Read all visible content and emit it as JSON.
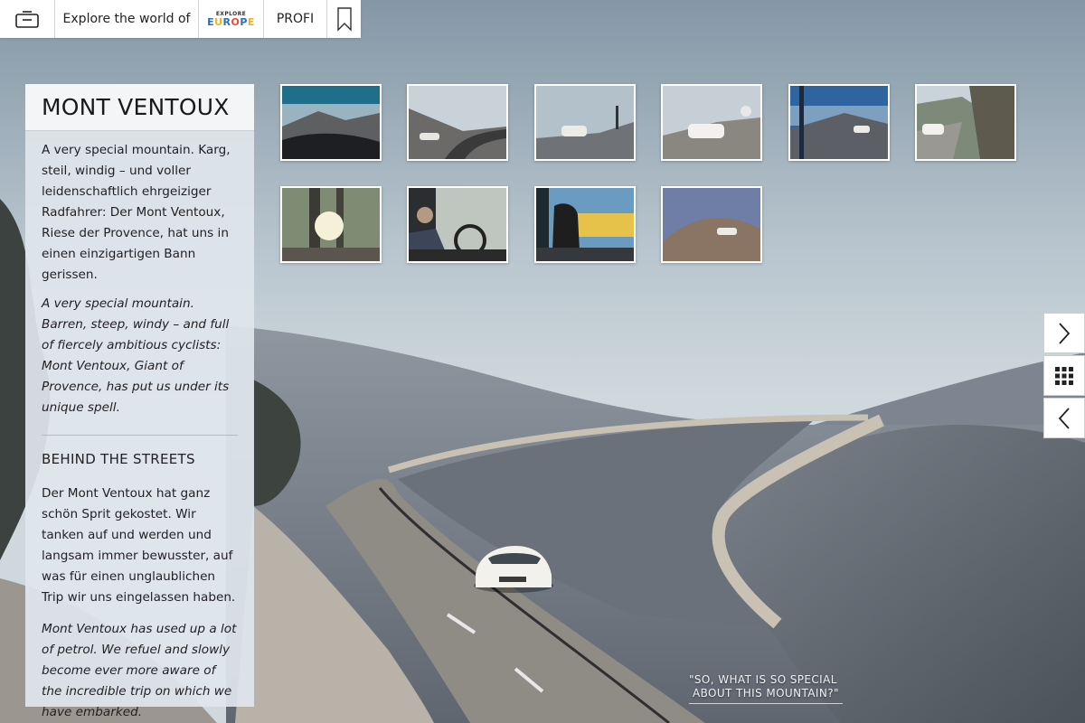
{
  "topbar": {
    "explore_label": "Explore the world of",
    "logo_small": "EXPLORE",
    "logo_main": "EUROPE",
    "profi_label": "PROFI",
    "icons": {
      "menu": "drawer-icon",
      "bookmark": "bookmark-icon"
    }
  },
  "panel": {
    "title": "MONT VENTOUX",
    "intro_de": "A very special mountain. Karg, steil, windig – und voller leidenschaftlich ehrgeiziger Radfahrer: Der Mont Ventoux, Riese der Provence, hat uns in einen einzigartigen Bann gerissen.",
    "intro_en": "A very special mountain. Barren, steep, windy – and full of fiercely ambitious cyclists: Mont Ventoux, Giant of Provence, has put us under its unique spell.",
    "section_title": "BEHIND THE STREETS",
    "section_de": "Der Mont Ventoux hat ganz schön Sprit gekostet. Wir tanken auf und werden und langsam immer bewusster, auf was für einen unglaublichen Trip wir uns eingelassen haben.",
    "section_en": "Mont Ventoux has used up a lot of petrol. We refuel and slowly become ever more aware of the incredible trip on which we have embarked."
  },
  "gallery": {
    "thumbnails": [
      "road-through-windshield",
      "winding-mountain-road",
      "car-at-summit-tower",
      "car-at-observatory",
      "road-with-pole",
      "car-on-cliff-road",
      "sunlight-through-trees",
      "driver-at-wheel",
      "man-at-gas-station",
      "car-on-summit-slope"
    ]
  },
  "nav": {
    "next_icon": "chevron-right-icon",
    "grid_icon": "grid-icon",
    "prev_icon": "chevron-left-icon"
  },
  "caption": {
    "line1": "\"SO, WHAT IS SO SPECIAL",
    "line2": "ABOUT THIS MOUNTAIN?\""
  },
  "colors": {
    "panel_bg": "#dfe5ec",
    "sky": "#a9b8c4",
    "road": "#8a8e93",
    "accent_logo": "#f3b21b"
  }
}
